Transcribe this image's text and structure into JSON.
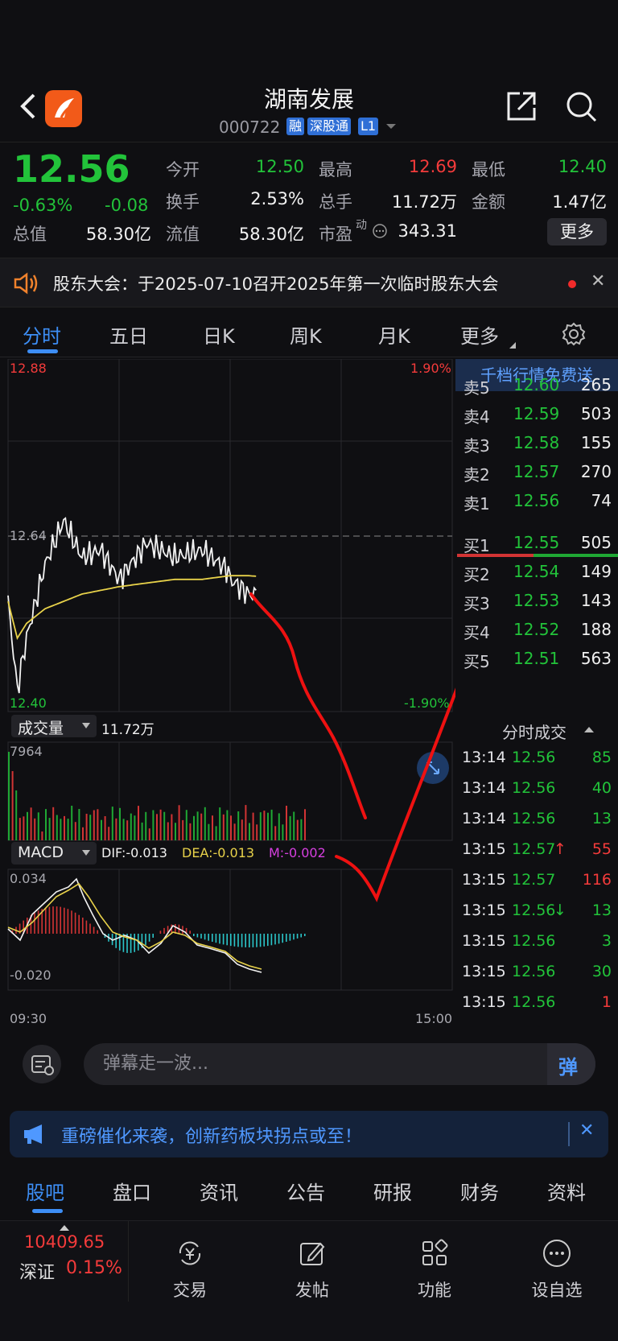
{
  "header": {
    "stock_name": "湖南发展",
    "stock_code": "000722",
    "tags": [
      "融",
      "深股通",
      "L1"
    ]
  },
  "quote": {
    "price": "12.56",
    "change_pct": "-0.63%",
    "change": "-0.08",
    "open_label": "今开",
    "open": "12.50",
    "high_label": "最高",
    "high": "12.69",
    "low_label": "最低",
    "low": "12.40",
    "turnover_label": "换手",
    "turnover": "2.53%",
    "volume_label": "总手",
    "volume": "11.72万",
    "amount_label": "金额",
    "amount": "1.47亿",
    "total_cap_label": "总值",
    "total_cap": "58.30亿",
    "float_cap_label": "流值",
    "float_cap": "58.30亿",
    "pe_label": "市盈",
    "pe_sup": "动",
    "pe": "343.31",
    "more_label": "更多"
  },
  "notice": {
    "text": "股东大会：于2025-07-10召开2025年第一次临时股东大会"
  },
  "chart_tabs": [
    "分时",
    "五日",
    "日K",
    "周K",
    "月K",
    "更多"
  ],
  "chart": {
    "top_price": "12.88",
    "top_pct": "1.90%",
    "mid_price": "12.64",
    "bottom_price": "12.40",
    "bottom_pct": "-1.90%",
    "volume_label": "成交量",
    "volume_total": "11.72万",
    "volume_max": "7964",
    "macd_label": "MACD",
    "dif": "DIF:-0.013",
    "dea": "DEA:-0.013",
    "m": "M:-0.002",
    "macd_top": "0.034",
    "macd_bottom": "-0.020",
    "time_start": "09:30",
    "time_end": "15:00"
  },
  "chart_data": {
    "type": "line",
    "x": [
      "09:30",
      "09:35",
      "09:40",
      "09:50",
      "10:00",
      "10:10",
      "10:20",
      "10:30",
      "10:45",
      "11:00",
      "11:15",
      "11:30",
      "13:00",
      "13:10",
      "13:15"
    ],
    "series": [
      {
        "values": [
          12.55,
          12.43,
          12.5,
          12.6,
          12.66,
          12.61,
          12.62,
          12.58,
          12.63,
          12.61,
          12.62,
          12.59,
          12.58,
          12.56,
          12.56
        ]
      },
      {
        "values": [
          12.55,
          12.5,
          12.52,
          12.54,
          12.55,
          12.56,
          12.565,
          12.57,
          12.575,
          12.58,
          12.58,
          12.585,
          12.585,
          12.585,
          12.584
        ]
      }
    ],
    "ylim": [
      12.4,
      12.88
    ],
    "grid": true
  },
  "order_book": {
    "banner": "千档行情免费送",
    "asks": [
      {
        "label": "卖5",
        "price": "12.60",
        "vol": "265"
      },
      {
        "label": "卖4",
        "price": "12.59",
        "vol": "503"
      },
      {
        "label": "卖3",
        "price": "12.58",
        "vol": "155"
      },
      {
        "label": "卖2",
        "price": "12.57",
        "vol": "270"
      },
      {
        "label": "卖1",
        "price": "12.56",
        "vol": "74"
      }
    ],
    "bids": [
      {
        "label": "买1",
        "price": "12.55",
        "vol": "505"
      },
      {
        "label": "买2",
        "price": "12.54",
        "vol": "149"
      },
      {
        "label": "买3",
        "price": "12.53",
        "vol": "143"
      },
      {
        "label": "买4",
        "price": "12.52",
        "vol": "188"
      },
      {
        "label": "买5",
        "price": "12.51",
        "vol": "563"
      }
    ],
    "trades_title": "分时成交",
    "trades": [
      {
        "time": "13:14",
        "price": "12.56",
        "vol": "85",
        "dir": ""
      },
      {
        "time": "13:14",
        "price": "12.56",
        "vol": "40",
        "dir": ""
      },
      {
        "time": "13:14",
        "price": "12.56",
        "vol": "13",
        "dir": ""
      },
      {
        "time": "13:15",
        "price": "12.57",
        "vol": "55",
        "dir": "↑"
      },
      {
        "time": "13:15",
        "price": "12.57",
        "vol": "116",
        "dir": ""
      },
      {
        "time": "13:15",
        "price": "12.56",
        "vol": "13",
        "dir": "↓"
      },
      {
        "time": "13:15",
        "price": "12.56",
        "vol": "3",
        "dir": ""
      },
      {
        "time": "13:15",
        "price": "12.56",
        "vol": "30",
        "dir": ""
      },
      {
        "time": "13:15",
        "price": "12.56",
        "vol": "1",
        "dir": ""
      }
    ]
  },
  "danmu": {
    "placeholder": "弹幕走一波...",
    "send": "弹"
  },
  "promo": {
    "text": "重磅催化来袭，创新药板块拐点或至！"
  },
  "bottom_tabs": [
    "股吧",
    "盘口",
    "资讯",
    "公告",
    "研报",
    "财务",
    "资料"
  ],
  "tab_bar": {
    "index_value": "10409.65",
    "index_name": "深证",
    "index_pct": "0.15%",
    "items": [
      "交易",
      "发帖",
      "功能",
      "设自选"
    ]
  },
  "colors": {
    "up": "#f43b3b",
    "down": "#22c33a",
    "accent": "#3d8ef5"
  }
}
